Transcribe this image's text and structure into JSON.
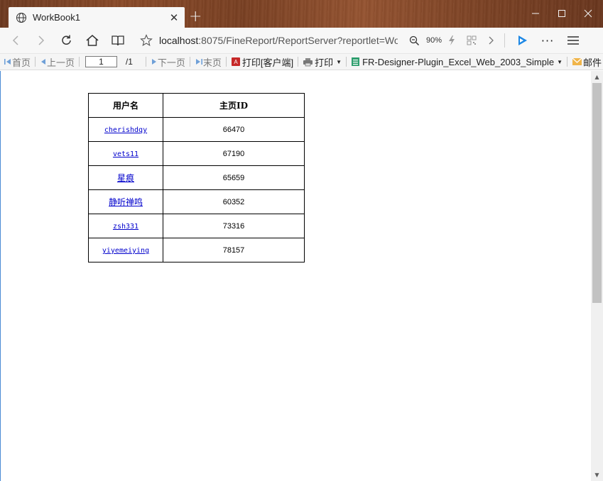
{
  "browser": {
    "tab_title": "WorkBook1",
    "tab_close": "✕",
    "new_tab": "+",
    "window_min": "—",
    "window_max": "☐",
    "window_close": "✕",
    "url_host": "localhost",
    "url_rest": ":8075/FineReport/ReportServer?reportlet=Wo",
    "zoom": "90%",
    "more": "···",
    "icons": [
      "back-icon",
      "forward-icon",
      "refresh-icon",
      "home-icon",
      "reading-view-icon",
      "favorite-star-icon",
      "zoom-icon",
      "lightning-icon",
      "qr-icon",
      "chevron-right-icon",
      "extension-icon",
      "more-icon",
      "menu-icon"
    ]
  },
  "toolbar": {
    "first": "首页",
    "prev": "上一页",
    "page_value": "1",
    "page_total": "/1",
    "next": "下一页",
    "last": "末页",
    "print_client": "打印[客户端]",
    "print": "打印",
    "plugin": "FR-Designer-Plugin_Excel_Web_2003_Simple",
    "mail": "邮件"
  },
  "report": {
    "headers": [
      "用户名",
      "主页ID"
    ],
    "rows": [
      {
        "user": "cherishdqy",
        "id": "66470"
      },
      {
        "user": "vets11",
        "id": "67190"
      },
      {
        "user": "星痕",
        "id": "65659"
      },
      {
        "user": "静听禅鸣",
        "id": "60352"
      },
      {
        "user": "zsh331",
        "id": "73316"
      },
      {
        "user": "yiyemeiying",
        "id": "78157"
      }
    ]
  },
  "colors": {
    "link": "#0000cc",
    "accent": "#4a8bd4",
    "titlebar": "#8a4a28"
  }
}
